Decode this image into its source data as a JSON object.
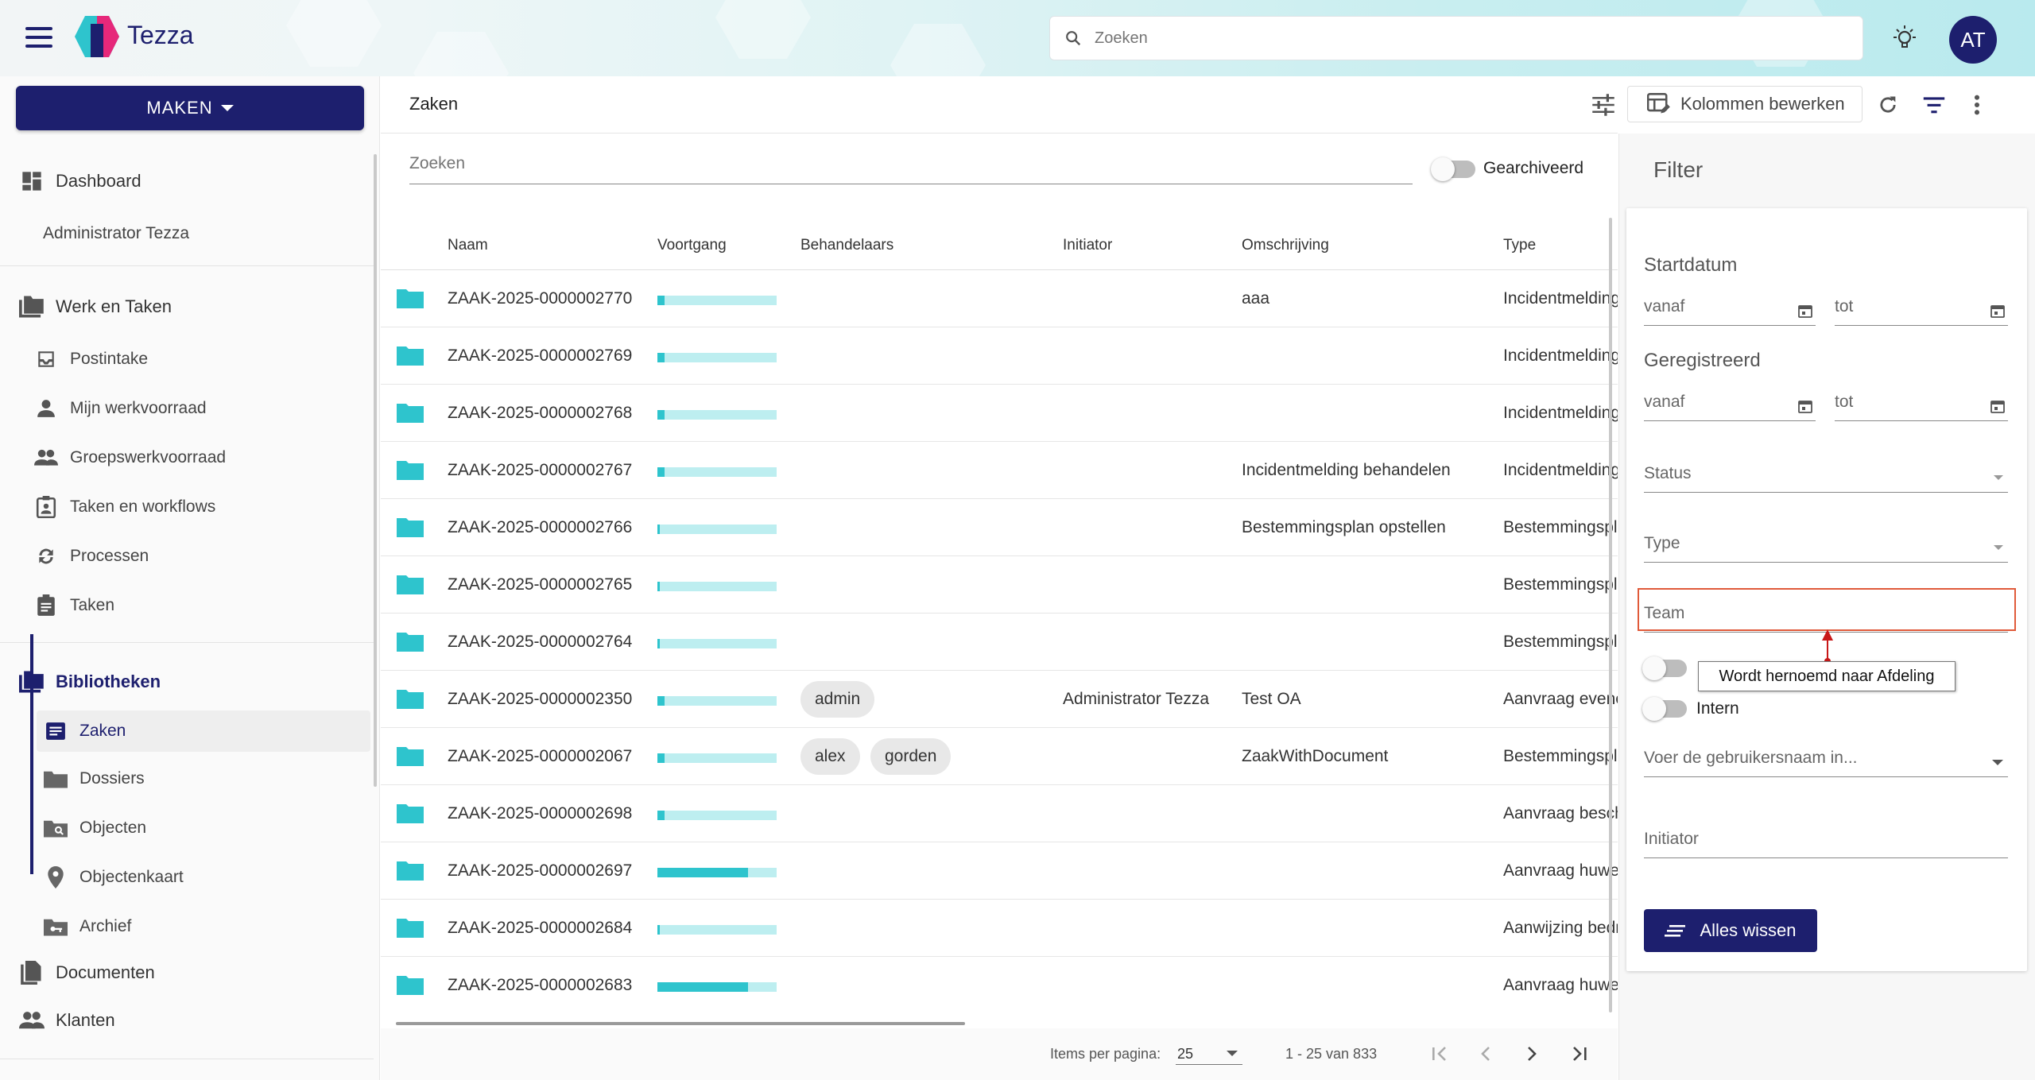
{
  "app": {
    "brand": "Tezza",
    "user_initials": "AT"
  },
  "search": {
    "placeholder": "Zoeken"
  },
  "sidebar": {
    "maken_label": "MAKEN",
    "dashboard": "Dashboard",
    "user_name": "Administrator Tezza",
    "werk_en_taken": "Werk en Taken",
    "werk_items": [
      "Postintake",
      "Mijn werkvoorraad",
      "Groepswerkvoorraad",
      "Taken en workflows",
      "Processen",
      "Taken"
    ],
    "bibliotheken": "Bibliotheken",
    "bib_items": [
      "Zaken",
      "Dossiers",
      "Objecten",
      "Objectenkaart",
      "Archief"
    ],
    "documenten": "Documenten",
    "klanten": "Klanten"
  },
  "main": {
    "title": "Zaken",
    "kolommen_label": "Kolommen bewerken",
    "search_placeholder": "Zoeken",
    "archived_label": "Gearchiveerd",
    "columns": [
      "Naam",
      "Voortgang",
      "Behandelaars",
      "Initiator",
      "Omschrijving",
      "Type"
    ],
    "rows": [
      {
        "naam": "ZAAK-2025-0000002770",
        "progress": 0.06,
        "chips": [],
        "initiator": "",
        "omschrijving": "aaa",
        "type": "Incidentmelding"
      },
      {
        "naam": "ZAAK-2025-0000002769",
        "progress": 0.06,
        "chips": [],
        "initiator": "",
        "omschrijving": "",
        "type": "Incidentmelding"
      },
      {
        "naam": "ZAAK-2025-0000002768",
        "progress": 0.06,
        "chips": [],
        "initiator": "",
        "omschrijving": "",
        "type": "Incidentmelding"
      },
      {
        "naam": "ZAAK-2025-0000002767",
        "progress": 0.06,
        "chips": [],
        "initiator": "",
        "omschrijving": "Incidentmelding behandelen",
        "type": "Incidentmelding"
      },
      {
        "naam": "ZAAK-2025-0000002766",
        "progress": 0.02,
        "chips": [],
        "initiator": "",
        "omschrijving": "Bestemmingsplan opstellen",
        "type": "Bestemmingsplan"
      },
      {
        "naam": "ZAAK-2025-0000002765",
        "progress": 0.02,
        "chips": [],
        "initiator": "",
        "omschrijving": "",
        "type": "Bestemmingsplan"
      },
      {
        "naam": "ZAAK-2025-0000002764",
        "progress": 0.02,
        "chips": [],
        "initiator": "",
        "omschrijving": "",
        "type": "Bestemmingsplan"
      },
      {
        "naam": "ZAAK-2025-0000002350",
        "progress": 0.06,
        "chips": [
          "admin"
        ],
        "initiator": "Administrator Tezza",
        "omschrijving": "Test OA",
        "type": "Aanvraag evenement"
      },
      {
        "naam": "ZAAK-2025-0000002067",
        "progress": 0.06,
        "chips": [
          "alex",
          "gorden"
        ],
        "initiator": "",
        "omschrijving": "ZaakWithDocument",
        "type": "Bestemmingsplan"
      },
      {
        "naam": "ZAAK-2025-0000002698",
        "progress": 0.06,
        "chips": [],
        "initiator": "",
        "omschrijving": "",
        "type": "Aanvraag beschikking"
      },
      {
        "naam": "ZAAK-2025-0000002697",
        "progress": 0.76,
        "chips": [],
        "initiator": "",
        "omschrijving": "",
        "type": "Aanvraag huwelijk"
      },
      {
        "naam": "ZAAK-2025-0000002684",
        "progress": 0.02,
        "chips": [],
        "initiator": "",
        "omschrijving": "",
        "type": "Aanwijzing bedrijf"
      },
      {
        "naam": "ZAAK-2025-0000002683",
        "progress": 0.76,
        "chips": [],
        "initiator": "",
        "omschrijving": "",
        "type": "Aanvraag huwelijk"
      }
    ],
    "items_per_page_label": "Items per pagina:",
    "items_per_page": "25",
    "range_label": "1 - 25 van 833"
  },
  "filter": {
    "title": "Filter",
    "startdatum": "Startdatum",
    "geregistreerd": "Geregistreerd",
    "vanaf": "vanaf",
    "tot": "tot",
    "status": "Status",
    "type": "Type",
    "team": "Team",
    "tooltip": "Wordt hernoemd naar Afdeling",
    "intern": "Intern",
    "user_placeholder": "Voer de gebruikersnaam in...",
    "initiator": "Initiator",
    "clear_label": "Alles wissen"
  },
  "colors": {
    "primary": "#1d1f6e",
    "accent": "#2ec4cd",
    "highlight": "#e05a3a"
  }
}
